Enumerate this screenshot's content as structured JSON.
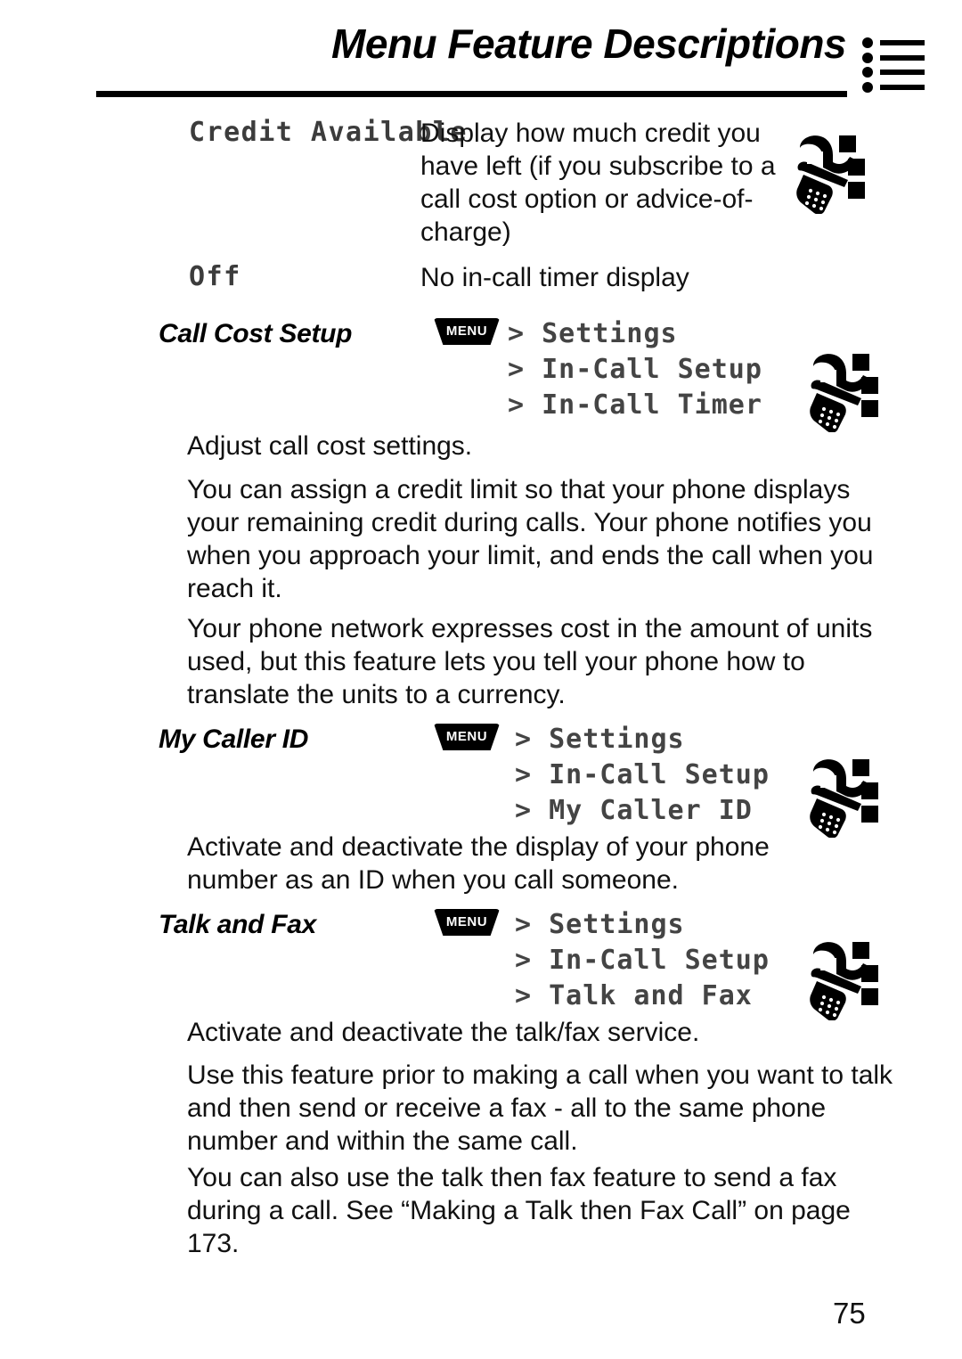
{
  "header": {
    "title": "Menu Feature Descriptions",
    "list_icon_rows": 4
  },
  "entries": [
    {
      "term": "Credit Available",
      "description": "Display how much credit you have left (if you subscribe to a call cost option or advice-of-charge)"
    },
    {
      "term": "Off",
      "description": "No in-call timer display"
    }
  ],
  "sections": [
    {
      "heading": "Call Cost Setup",
      "menu_key_label": "MENU",
      "path": [
        "> Settings",
        "> In-Call Setup",
        "> In-Call Timer"
      ],
      "paragraphs": [
        "Adjust call cost settings.",
        "You can assign a credit limit so that your phone displays your remaining credit during calls. Your phone notifies you when you approach your limit, and ends the call when you reach it.",
        "Your phone network expresses cost in the amount of units used, but this feature lets you tell your phone how to translate the units to a currency."
      ]
    },
    {
      "heading": "My Caller ID",
      "menu_key_label": "MENU",
      "path": [
        "> Settings",
        "> In-Call Setup",
        "> My Caller ID"
      ],
      "paragraphs": [
        "Activate and deactivate the display of your phone number as an ID when you call someone."
      ]
    },
    {
      "heading": "Talk and Fax",
      "menu_key_label": "MENU",
      "path": [
        "> Settings",
        "> In-Call Setup",
        "> Talk and Fax"
      ],
      "paragraphs": [
        "Activate and deactivate the talk/fax service.",
        "Use this feature prior to making a call when you want to talk and then send or receive a fax - all to the same phone number and within the same call.",
        "You can also use the talk then fax feature to send a fax during a call. See “Making a Talk then Fax Call” on page 173."
      ]
    }
  ],
  "footer": {
    "page_number": "75"
  },
  "icons": {
    "list_icon": "bulleted-list-icon",
    "phone_icon": "flip-phone-signal-icon",
    "menu_key": "menu-key-icon"
  },
  "colors": {
    "text": "#111111",
    "term": "#3c3c3c",
    "path": "#444444",
    "rule": "#000000"
  }
}
